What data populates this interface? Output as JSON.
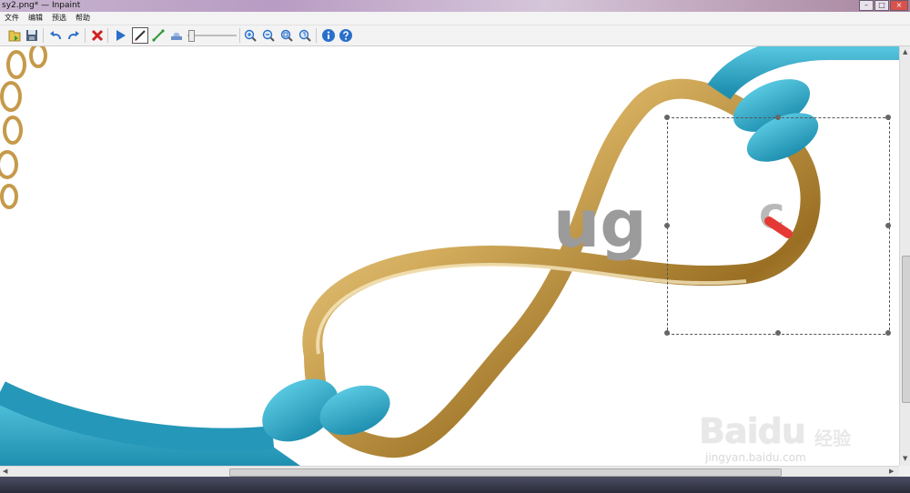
{
  "window": {
    "title": "sy2.png* — Inpaint",
    "controls": [
      "–",
      "□",
      "×"
    ]
  },
  "menu": {
    "items": [
      "文件",
      "编辑",
      "预选",
      "帮助"
    ]
  },
  "toolbar": {
    "tools": [
      {
        "icon": "open-icon"
      },
      {
        "icon": "save-icon"
      },
      {
        "icon": "undo-icon"
      },
      {
        "icon": "redo-icon"
      },
      {
        "icon": "clear-selection-icon"
      },
      {
        "icon": "run-icon"
      },
      {
        "icon": "marker-icon"
      },
      {
        "icon": "line-icon"
      },
      {
        "icon": "eraser-icon"
      },
      {
        "icon": "zoom-in-icon"
      },
      {
        "icon": "zoom-out-icon"
      },
      {
        "icon": "zoom-fit-icon"
      },
      {
        "icon": "zoom-actual-icon"
      },
      {
        "icon": "info-icon"
      },
      {
        "icon": "help-icon"
      }
    ]
  },
  "image": {
    "watermark_fragment": "ug",
    "selection_mark": "c",
    "baidu_logo": "Baidu",
    "baidu_suffix": "经验",
    "baidu_url": "jingyan.baidu.com"
  },
  "colors": {
    "accent": "#2a6fc9",
    "cord": "#26a6c4",
    "gold": "#caa35a",
    "mark": "#e53935"
  }
}
